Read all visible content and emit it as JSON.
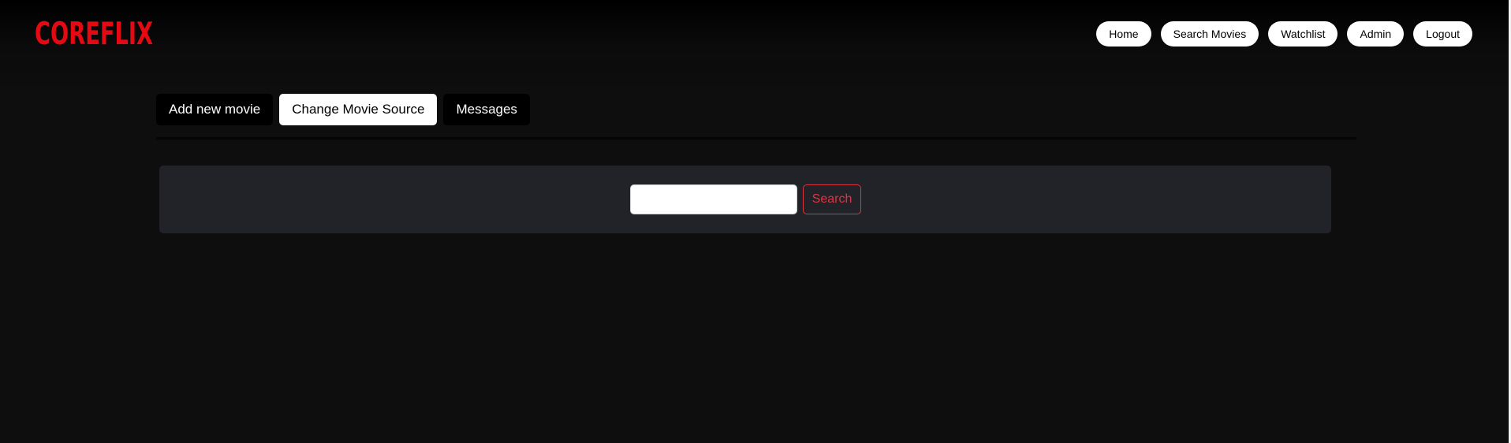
{
  "brand": {
    "logo_text": "COREFLIX",
    "logo_color": "#e50914"
  },
  "navbar": {
    "links": [
      {
        "label": "Home"
      },
      {
        "label": "Search Movies"
      },
      {
        "label": "Watchlist"
      },
      {
        "label": "Admin"
      },
      {
        "label": "Logout"
      }
    ]
  },
  "tabs": {
    "items": [
      {
        "label": "Add new movie",
        "active": false
      },
      {
        "label": "Change Movie Source",
        "active": true
      },
      {
        "label": "Messages",
        "active": false
      }
    ]
  },
  "search": {
    "input_value": "",
    "placeholder": "",
    "button_label": "Search"
  },
  "colors": {
    "accent": "#dc3545",
    "panel": "#212328",
    "background": "#0e0e0e"
  }
}
